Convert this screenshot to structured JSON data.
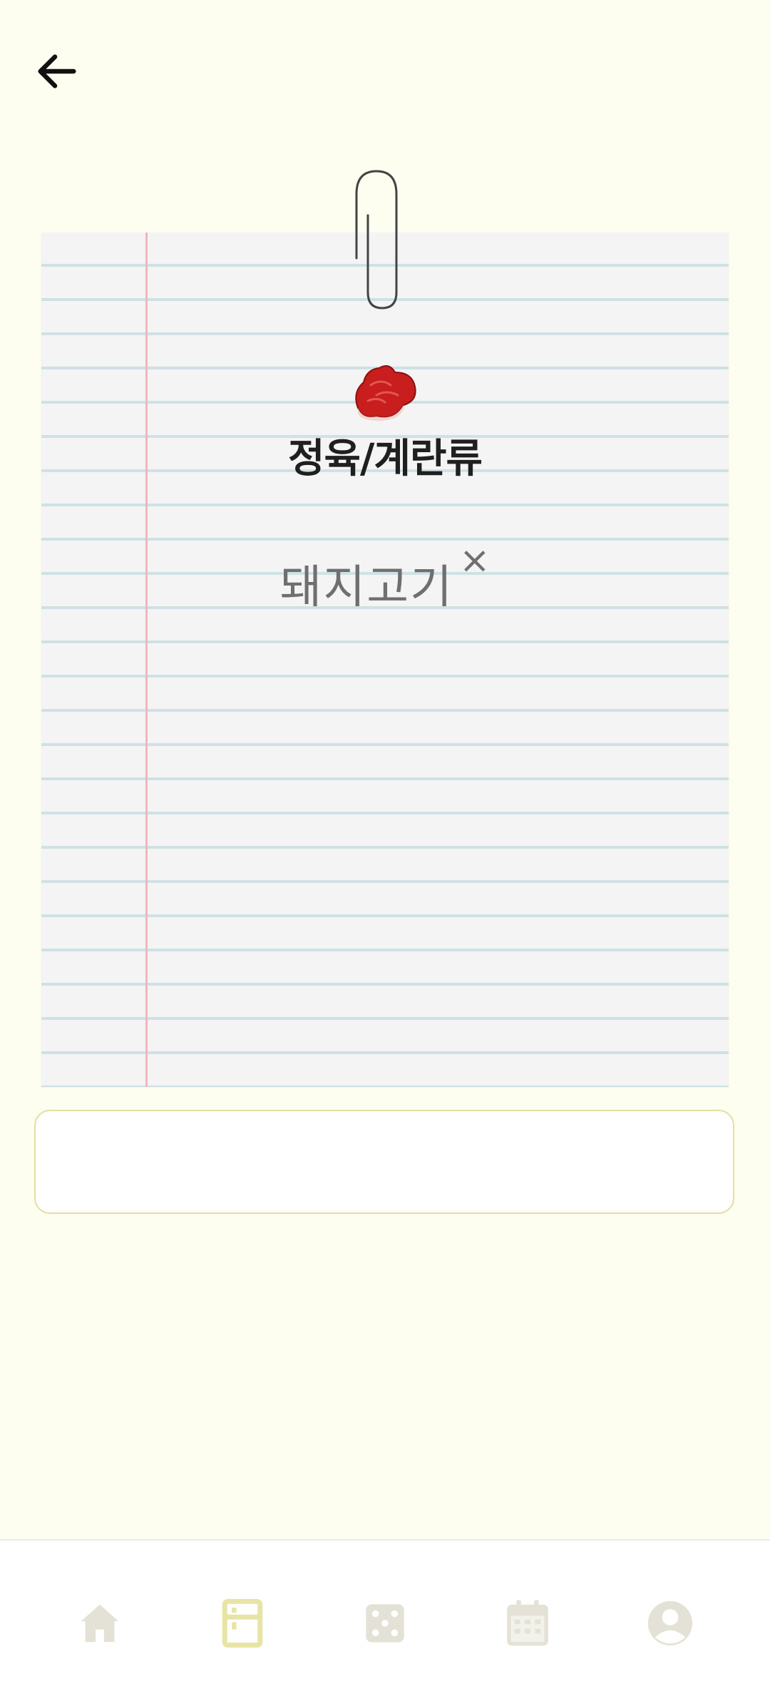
{
  "header": {
    "back_icon": "arrow-left-icon"
  },
  "category": {
    "icon": "meat-steak-icon",
    "title": "정육/계란류"
  },
  "items": [
    {
      "label": "돼지고기",
      "remove_symbol": "×"
    }
  ],
  "input": {
    "value": "",
    "placeholder": ""
  },
  "bottom_nav": {
    "items": [
      {
        "icon": "home-icon",
        "active": false
      },
      {
        "icon": "fridge-icon",
        "active": true
      },
      {
        "icon": "dice-icon",
        "active": false
      },
      {
        "icon": "calendar-icon",
        "active": false
      },
      {
        "icon": "profile-icon",
        "active": false
      }
    ],
    "colors": {
      "active": "#e8e4a6",
      "inactive": "#e4e2d6"
    }
  },
  "colors": {
    "background": "#fdfdf0",
    "paper": "#f4f4f4",
    "ruled_line": "#cfe1e4",
    "margin_line": "#f2b5bd",
    "input_border": "#e3dfa0"
  }
}
